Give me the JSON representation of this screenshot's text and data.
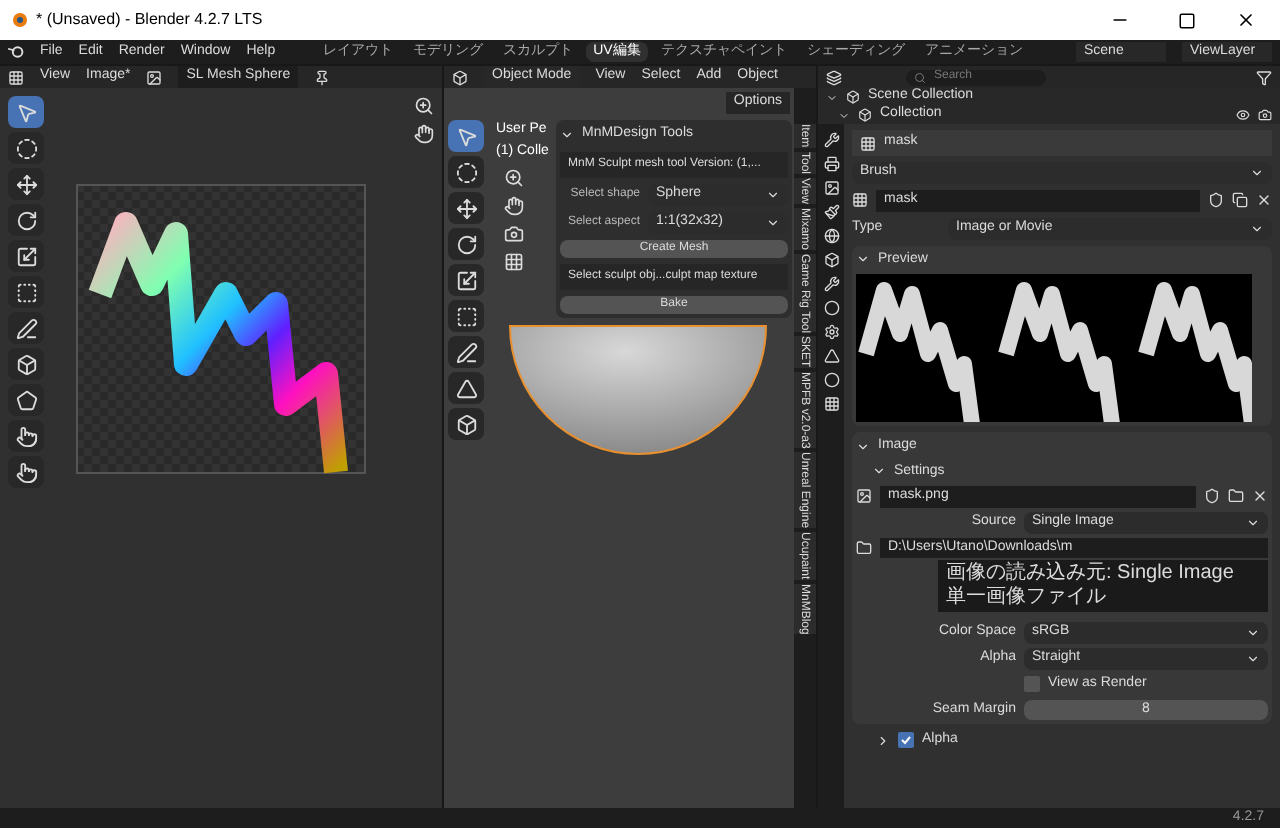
{
  "window": {
    "title": "* (Unsaved) - Blender 4.2.7 LTS"
  },
  "menu": [
    "File",
    "Edit",
    "Render",
    "Window",
    "Help"
  ],
  "workspaces": [
    {
      "label": "レイアウト",
      "selected": false
    },
    {
      "label": "モデリング",
      "selected": false
    },
    {
      "label": "スカルプト",
      "selected": false
    },
    {
      "label": "UV編集",
      "selected": true
    },
    {
      "label": "テクスチャペイント",
      "selected": false
    },
    {
      "label": "シェーディング",
      "selected": false
    },
    {
      "label": "アニメーション",
      "selected": false
    }
  ],
  "scene": "Scene",
  "view_layer": "ViewLayer",
  "image_editor": {
    "menus": [
      "View",
      "Image*"
    ],
    "image_name": "SL Mesh Sphere"
  },
  "viewport": {
    "mode": "Object Mode",
    "menus": [
      "View",
      "Select",
      "Add",
      "Object"
    ],
    "options": "Options",
    "overlay_text": [
      "User Pe",
      "(1) Colle"
    ],
    "panel": {
      "title": "MnMDesign Tools",
      "expanded": true,
      "version": "MnM Sculpt mesh tool Version: (1,...",
      "fields": [
        {
          "label": "Select shape",
          "value": "Sphere"
        },
        {
          "label": "Select aspect",
          "value": "1:1(32x32)"
        }
      ],
      "create": "Create Mesh",
      "sculpt": "Select sculpt obj...culpt map texture",
      "bake": "Bake"
    },
    "tabs": [
      {
        "label": "Item",
        "selected": false
      },
      {
        "label": "Tool",
        "selected": false
      },
      {
        "label": "View",
        "selected": false
      },
      {
        "label": "Mixamo",
        "selected": false
      },
      {
        "label": "Game Rig Tool",
        "selected": false
      },
      {
        "label": "SKET",
        "selected": false
      },
      {
        "label": "MPFB v2.0-a3",
        "selected": false
      },
      {
        "label": "Unreal Engine",
        "selected": false
      },
      {
        "label": "Ucupaint",
        "selected": false
      },
      {
        "label": "MnMBlog",
        "selected": false
      }
    ]
  },
  "outliner": {
    "search_placeholder": "Search",
    "items": [
      {
        "label": "Scene Collection",
        "expanded": true
      },
      {
        "label": "Collection",
        "expanded": true
      }
    ]
  },
  "properties": {
    "slot": "mask",
    "brush": "Brush",
    "texture_name": "mask",
    "type_label": "Type",
    "type_value": "Image or Movie",
    "preview": {
      "title": "Preview",
      "expanded": true
    },
    "image": {
      "title": "Image",
      "expanded": true,
      "settings": "Settings",
      "file": "mask.png",
      "source_label": "Source",
      "source_value": "Single Image",
      "path": "D:\\Users\\Utano\\Downloads\\m",
      "rows": [
        {
          "kind": "dropdown",
          "label": "Color Space",
          "value": "sRGB"
        },
        {
          "kind": "dropdown",
          "label": "Alpha",
          "value": "Straight"
        },
        {
          "kind": "checkbox",
          "label": "View as Render",
          "checked": false
        },
        {
          "kind": "number",
          "label": "Seam Margin",
          "value": "8"
        }
      ]
    },
    "alpha": {
      "label": "Alpha",
      "expanded": false,
      "checked": true
    }
  },
  "tooltip": {
    "lines": [
      "画像の読み込み元: Single Image",
      "単一画像ファイル"
    ]
  },
  "status_bar": {
    "version": "4.2.7"
  }
}
